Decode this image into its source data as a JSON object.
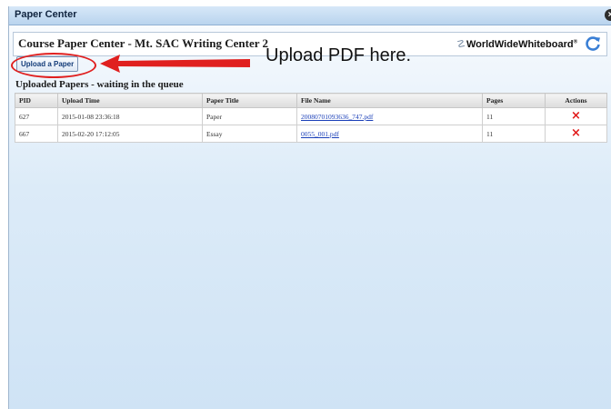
{
  "window": {
    "title": "Paper Center",
    "close_glyph": "×"
  },
  "header": {
    "course_title": "Course Paper Center - Mt. SAC Writing Center 2",
    "brand_mark": "☡",
    "brand": "WorldWideWhiteboard",
    "brand_tm": "®",
    "refresh_icon": "refresh-icon"
  },
  "upload_button": {
    "label": "Upload a Paper"
  },
  "annotation": {
    "text": "Upload PDF here.",
    "color": "#e0201f"
  },
  "queue": {
    "heading": "Uploaded Papers - waiting in the queue",
    "columns": [
      "PID",
      "Upload Time",
      "Paper Title",
      "File Name",
      "Pages",
      "Actions"
    ],
    "rows": [
      {
        "pid": "627",
        "upload_time": "2015-01-08 23:36:18",
        "paper_title": "Paper",
        "file_name": "20080701093636_747.pdf",
        "pages": "11",
        "action_icon": "×"
      },
      {
        "pid": "667",
        "upload_time": "2015-02-20 17:12:05",
        "paper_title": "Essay",
        "file_name": "0055_001.pdf",
        "pages": "11",
        "action_icon": "×"
      }
    ]
  }
}
